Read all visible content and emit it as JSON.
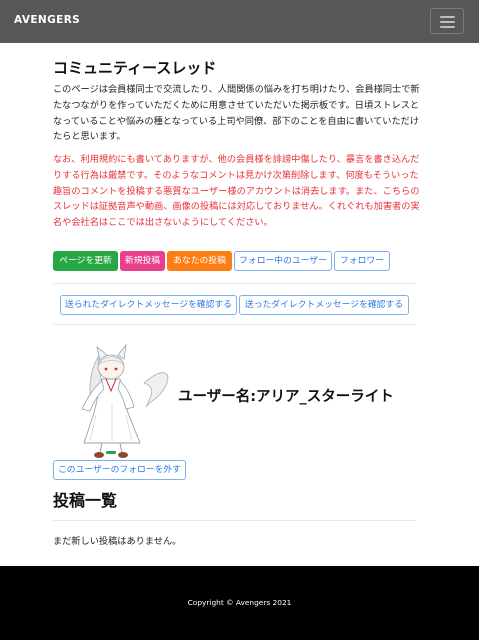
{
  "navbar": {
    "brand": "AVENGERS",
    "toggle_icon": "hamburger-menu-icon"
  },
  "community": {
    "title": "コミュニティースレッド",
    "intro": "このページは会員様同士で交流したり、人間関係の悩みを打ち明けたり、会員様同士で新たなつながりを作っていただくために用意させていただいた掲示板です。日頃ストレスとなっていることや悩みの種となっている上司や同僚、部下のことを自由に書いていただけたらと思います。",
    "warning": "なお、利用規約にも書いてありますが、他の会員様を誹謗中傷したり、暴言を書き込んだりする行為は厳禁です。そのようなコメントは見かけ次第削除します、何度もそういった趣旨のコメントを投稿する悪質なユーザー様のアカウントは消去します。また、こちらのスレッドは証拠音声や動画、画像の投稿には対応しておりません。くれぐれも加害者の実名や会社名はここでは出さないようにしてください。",
    "warning_color": "#e8323a"
  },
  "actions": {
    "refresh": "ページを更新",
    "new_post": "新規投稿",
    "your_posts": "あなたの投稿",
    "following": "フォロー中のユーザー",
    "followers": "フォロワー"
  },
  "dm": {
    "received": "送られたダイレクトメッセージを確認する",
    "sent": "送ったダイレクトメッセージを確認する"
  },
  "profile": {
    "username": "ユーザー名:アリア_スターライト",
    "unfollow": "このユーザーのフォローを外す",
    "avatar_icon": "anime-character-avatar"
  },
  "posts": {
    "heading": "投稿一覧",
    "empty": "まだ新しい投稿はありません。"
  },
  "footer": {
    "copyright": "Copyright © Avengers 2021"
  },
  "colors": {
    "navbar": "#575757",
    "refresh": "#28a745",
    "new_post": "#e83e8c",
    "your_posts": "#fd7e14",
    "outline": "#2a7ae2",
    "footer": "#000000"
  }
}
